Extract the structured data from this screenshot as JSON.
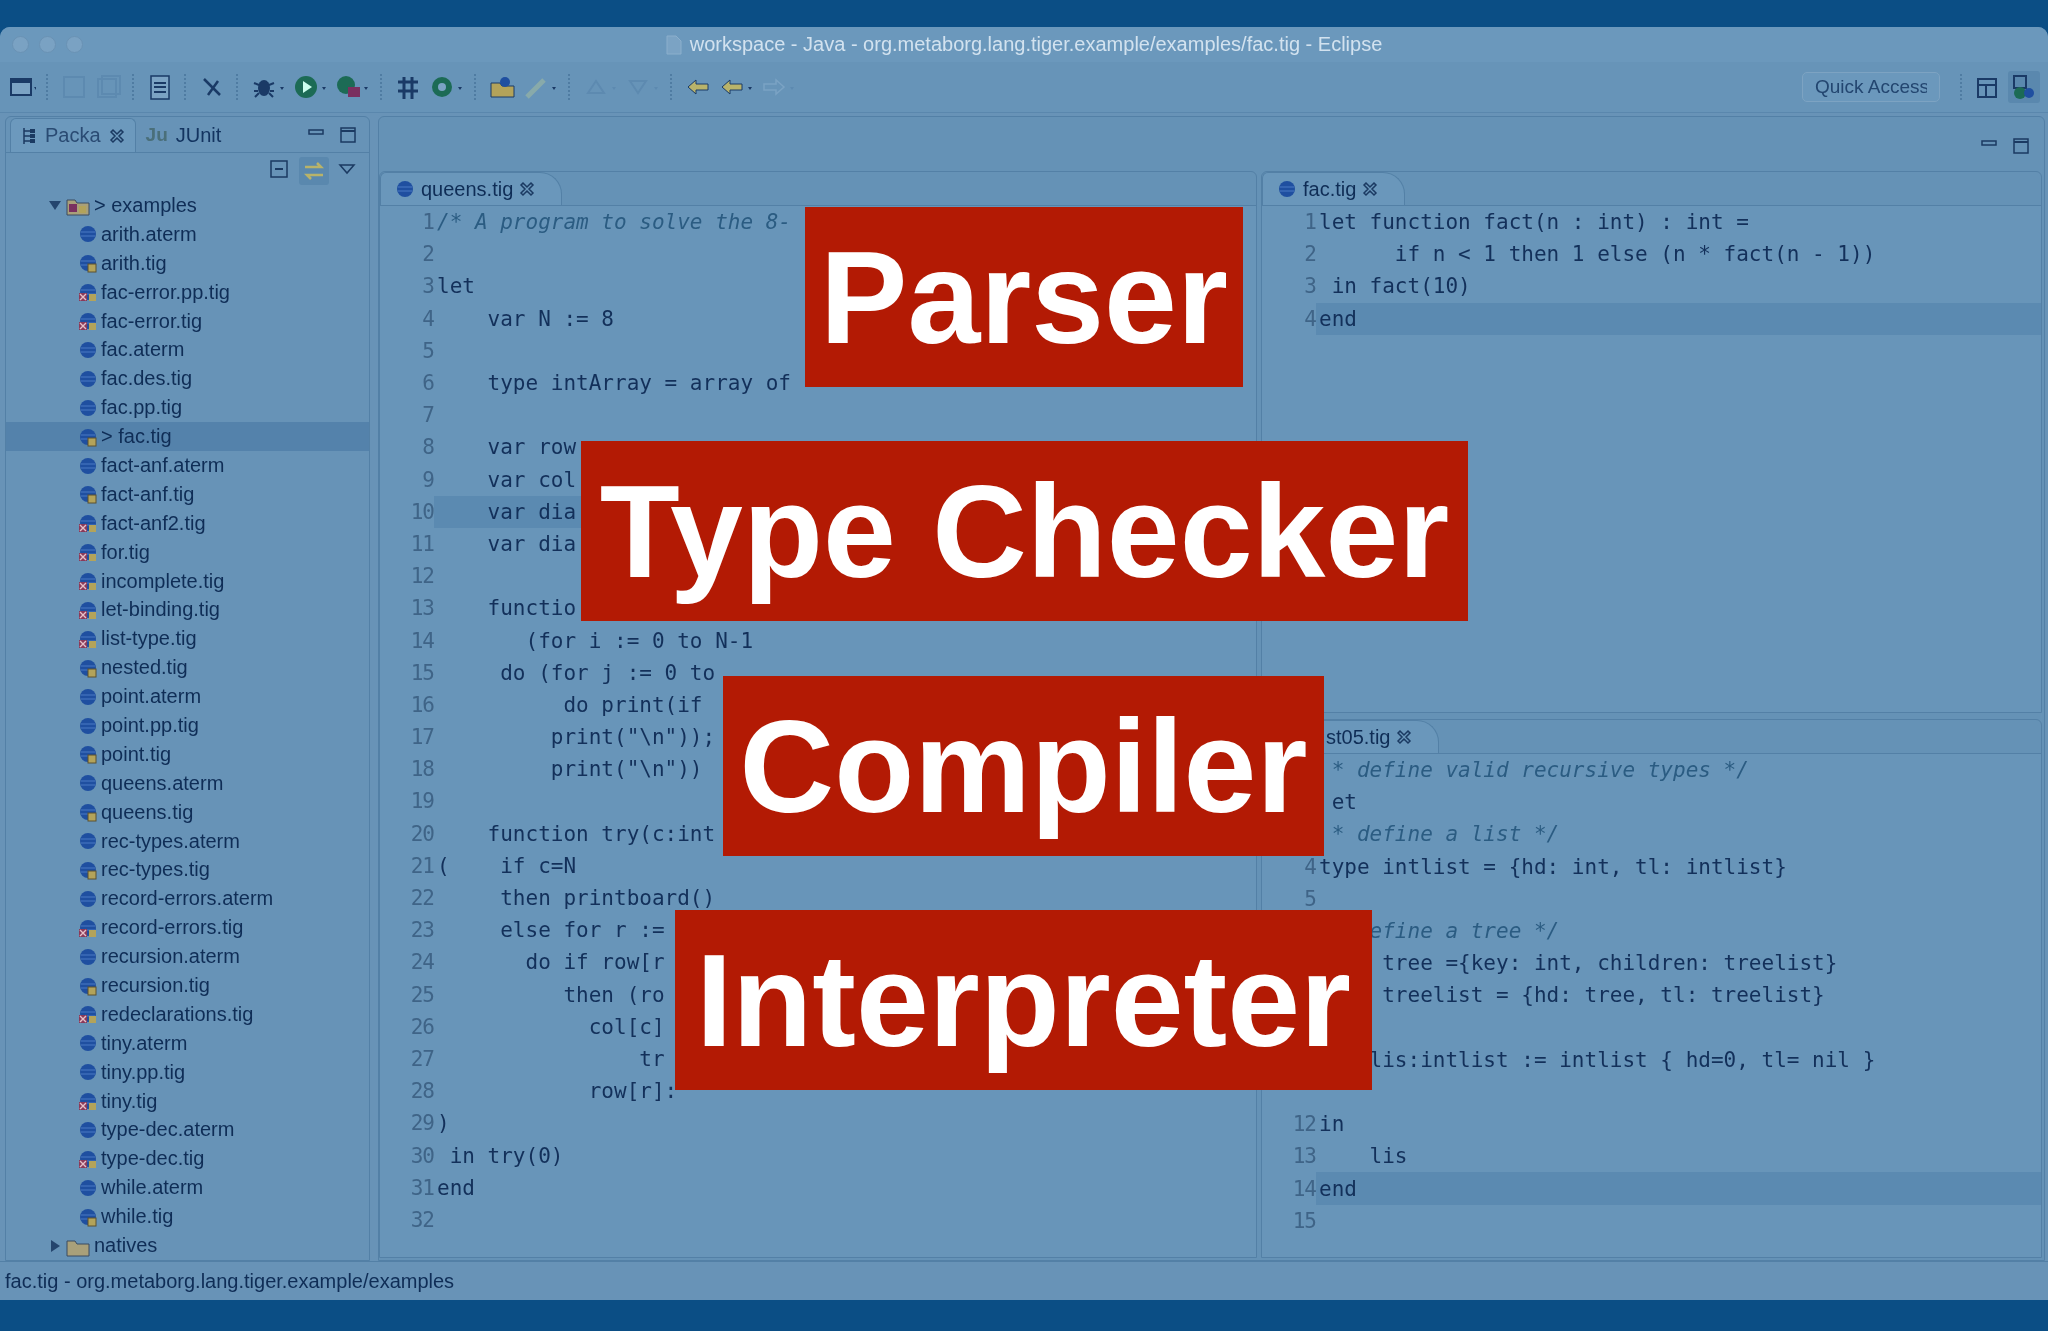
{
  "window": {
    "title": "workspace - Java - org.metaborg.lang.tiger.example/examples/fac.tig - Eclipse"
  },
  "toolbar": {
    "quick_access": {
      "placeholder": "Quick Access"
    }
  },
  "side_panel": {
    "tabs": [
      {
        "label": "Packa",
        "selected": true,
        "closable": true
      },
      {
        "label": "JUnit",
        "icon_text": "Ju",
        "selected": false,
        "closable": false
      }
    ],
    "tree": [
      {
        "label": "> examples",
        "expanded": true,
        "selected": false,
        "children": [
          {
            "label": "arith.aterm",
            "kind": "plain",
            "selected": false
          },
          {
            "label": "arith.tig",
            "kind": "file",
            "selected": false
          },
          {
            "label": "fac-error.pp.tig",
            "kind": "error",
            "selected": false
          },
          {
            "label": "fac-error.tig",
            "kind": "error",
            "selected": false
          },
          {
            "label": "fac.aterm",
            "kind": "plain",
            "selected": false
          },
          {
            "label": "fac.des.tig",
            "kind": "plain",
            "selected": false
          },
          {
            "label": "fac.pp.tig",
            "kind": "plain",
            "selected": false
          },
          {
            "label": "> fac.tig",
            "kind": "file",
            "selected": true
          },
          {
            "label": "fact-anf.aterm",
            "kind": "plain",
            "selected": false
          },
          {
            "label": "fact-anf.tig",
            "kind": "file",
            "selected": false
          },
          {
            "label": "fact-anf2.tig",
            "kind": "error",
            "selected": false
          },
          {
            "label": "for.tig",
            "kind": "error",
            "selected": false
          },
          {
            "label": "incomplete.tig",
            "kind": "error",
            "selected": false
          },
          {
            "label": "let-binding.tig",
            "kind": "error",
            "selected": false
          },
          {
            "label": "list-type.tig",
            "kind": "error",
            "selected": false
          },
          {
            "label": "nested.tig",
            "kind": "file",
            "selected": false
          },
          {
            "label": "point.aterm",
            "kind": "plain",
            "selected": false
          },
          {
            "label": "point.pp.tig",
            "kind": "plain",
            "selected": false
          },
          {
            "label": "point.tig",
            "kind": "file",
            "selected": false
          },
          {
            "label": "queens.aterm",
            "kind": "plain",
            "selected": false
          },
          {
            "label": "queens.tig",
            "kind": "file",
            "selected": false
          },
          {
            "label": "rec-types.aterm",
            "kind": "plain",
            "selected": false
          },
          {
            "label": "rec-types.tig",
            "kind": "file",
            "selected": false
          },
          {
            "label": "record-errors.aterm",
            "kind": "plain",
            "selected": false
          },
          {
            "label": "record-errors.tig",
            "kind": "error",
            "selected": false
          },
          {
            "label": "recursion.aterm",
            "kind": "plain",
            "selected": false
          },
          {
            "label": "recursion.tig",
            "kind": "file",
            "selected": false
          },
          {
            "label": "redeclarations.tig",
            "kind": "error",
            "selected": false
          },
          {
            "label": "tiny.aterm",
            "kind": "plain",
            "selected": false
          },
          {
            "label": "tiny.pp.tig",
            "kind": "plain",
            "selected": false
          },
          {
            "label": "tiny.tig",
            "kind": "error",
            "selected": false
          },
          {
            "label": "type-dec.aterm",
            "kind": "plain",
            "selected": false
          },
          {
            "label": "type-dec.tig",
            "kind": "error",
            "selected": false
          },
          {
            "label": "while.aterm",
            "kind": "plain",
            "selected": false
          },
          {
            "label": "while.tig",
            "kind": "file",
            "selected": false
          }
        ]
      },
      {
        "label": "natives",
        "expanded": false,
        "selected": false
      }
    ]
  },
  "editors": [
    {
      "tab": "queens.tig",
      "tab_icon": true,
      "lines": [
        {
          "number": "1",
          "text": "/* A program to solve the 8-",
          "kind": "comment"
        },
        {
          "number": "2"
        },
        {
          "number": "3",
          "text": "let"
        },
        {
          "number": "4",
          "text": "    var N := 8"
        },
        {
          "number": "5"
        },
        {
          "number": "6",
          "text": "    type intArray = array of"
        },
        {
          "number": "7"
        },
        {
          "number": "8",
          "text": "    var row"
        },
        {
          "number": "9",
          "text": "    var col"
        },
        {
          "number": "10",
          "text": "    var dia",
          "current": true
        },
        {
          "number": "11",
          "text": "    var dia"
        },
        {
          "number": "12"
        },
        {
          "number": "13",
          "text": "    functio"
        },
        {
          "number": "14",
          "text": "       (for i := 0 to N-1"
        },
        {
          "number": "15",
          "text": "     do (for j := 0 to"
        },
        {
          "number": "16",
          "text": "          do print(if"
        },
        {
          "number": "17",
          "text": "         print(\"\\n\"));"
        },
        {
          "number": "18",
          "text": "         print(\"\\n\"))"
        },
        {
          "number": "19"
        },
        {
          "number": "20",
          "text": "    function try(c:int"
        },
        {
          "number": "21",
          "text": "(    if c=N"
        },
        {
          "number": "22",
          "text": "     then printboard()"
        },
        {
          "number": "23",
          "text": "     else for r :="
        },
        {
          "number": "24",
          "text": "       do if row[r"
        },
        {
          "number": "25",
          "text": "          then (ro"
        },
        {
          "number": "26",
          "text": "            col[c]"
        },
        {
          "number": "27",
          "text": "                tr"
        },
        {
          "number": "28",
          "text": "            row[r]:"
        },
        {
          "number": "29",
          "text": ")"
        },
        {
          "number": "30",
          "text": " in try(0)"
        },
        {
          "number": "31",
          "text": "end"
        },
        {
          "number": "32"
        }
      ]
    },
    {
      "tab": "fac.tig",
      "tab_icon": true,
      "lines": [
        {
          "number": "1",
          "text": "let function fact(n : int) : int ="
        },
        {
          "number": "2",
          "text": "      if n < 1 then 1 else (n * fact(n - 1))"
        },
        {
          "number": "3",
          "text": " in fact(10)"
        },
        {
          "number": "4",
          "text": "end",
          "current": true
        }
      ]
    },
    {
      "tab": "st05.tig",
      "tab_icon": false,
      "lines": [
        {
          "text": " * define valid recursive types */",
          "kind": "comment"
        },
        {
          "text": " et"
        },
        {
          "text": " * define a list */",
          "kind": "comment"
        },
        {
          "number": "4",
          "text": "type intlist = {hd: int, tl: intlist}"
        },
        {
          "number": "5"
        },
        {
          "text": "    efine a tree */",
          "kind": "comment"
        },
        {
          "text": "     tree ={key: int, children: treelist}"
        },
        {
          "text": "     treelist = {hd: tree, tl: treelist}"
        },
        {
          "kind": "blank"
        },
        {
          "text": "    lis:intlist := intlist { hd=0, tl= nil }"
        },
        {
          "kind": "blank"
        },
        {
          "number": "12",
          "text": "in"
        },
        {
          "number": "13",
          "text": "    lis"
        },
        {
          "number": "14",
          "text": "end",
          "current": true
        },
        {
          "number": "15"
        }
      ]
    }
  ],
  "status_bar": {
    "text": "fac.tig - org.metaborg.lang.tiger.example/examples"
  },
  "banners": [
    {
      "text": "Parser"
    },
    {
      "text": "Type Checker"
    },
    {
      "text": "Compiler"
    },
    {
      "text": "Interpreter"
    }
  ]
}
